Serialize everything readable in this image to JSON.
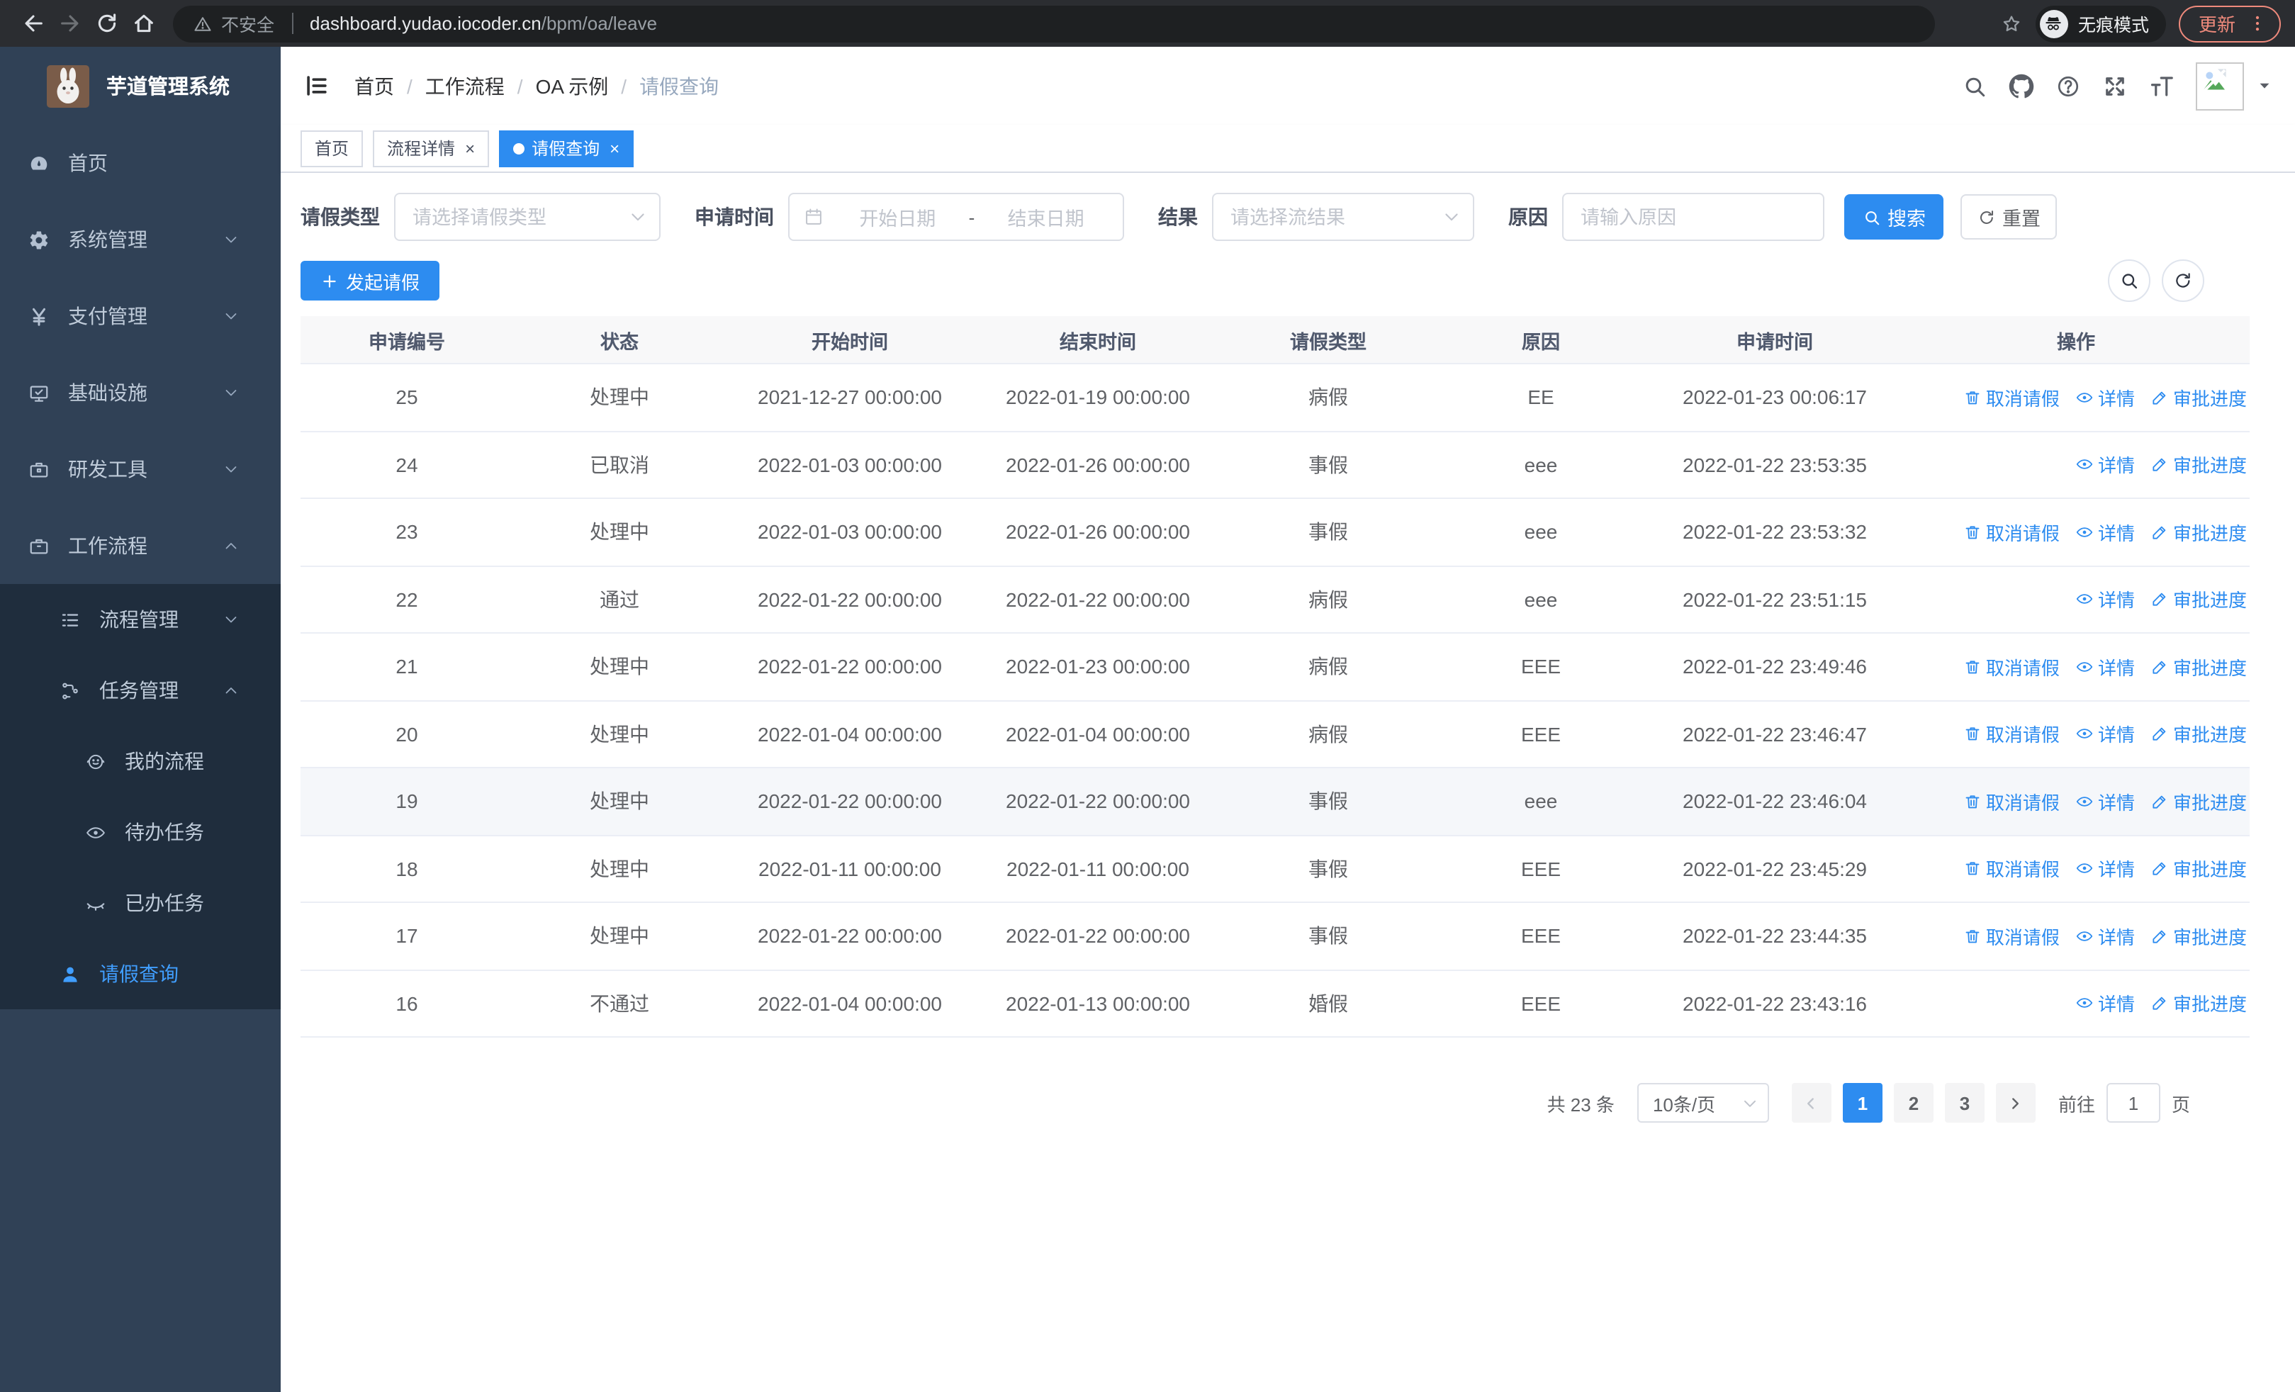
{
  "browser": {
    "security_label": "不安全",
    "url_host": "dashboard.yudao.iocoder.cn",
    "url_path": "/bpm/oa/leave",
    "incognito_label": "无痕模式",
    "update_label": "更新"
  },
  "sidebar": {
    "title": "芋道管理系统",
    "items": [
      {
        "key": "home",
        "label": "首页",
        "icon": "dashboard",
        "level": 1
      },
      {
        "key": "system-mgmt",
        "label": "系统管理",
        "icon": "gear",
        "level": 1,
        "chevron": "down"
      },
      {
        "key": "payment-mgmt",
        "label": "支付管理",
        "icon": "yen",
        "level": 1,
        "chevron": "down"
      },
      {
        "key": "infrastructure",
        "label": "基础设施",
        "icon": "monitor",
        "level": 1,
        "chevron": "down"
      },
      {
        "key": "dev-tools",
        "label": "研发工具",
        "icon": "toolbox",
        "level": 1,
        "chevron": "down"
      },
      {
        "key": "workflow",
        "label": "工作流程",
        "icon": "briefcase",
        "level": 1,
        "chevron": "up"
      },
      {
        "key": "process-mgmt",
        "label": "流程管理",
        "icon": "list",
        "level": 2,
        "chevron": "down",
        "dark": true
      },
      {
        "key": "task-mgmt",
        "label": "任务管理",
        "icon": "flow",
        "level": 2,
        "chevron": "up",
        "dark": true
      },
      {
        "key": "my-process",
        "label": "我的流程",
        "icon": "face",
        "level": 3,
        "dark": true
      },
      {
        "key": "todo-tasks",
        "label": "待办任务",
        "icon": "eye",
        "level": 3,
        "dark": true
      },
      {
        "key": "done-tasks",
        "label": "已办任务",
        "icon": "eye-closed",
        "level": 3,
        "dark": true
      },
      {
        "key": "leave-query",
        "label": "请假查询",
        "icon": "user",
        "level": 2,
        "dark": true,
        "active": true
      }
    ]
  },
  "breadcrumb": [
    "首页",
    "工作流程",
    "OA 示例",
    "请假查询"
  ],
  "tabs": [
    {
      "label": "首页",
      "closable": false,
      "active": false
    },
    {
      "label": "流程详情",
      "closable": true,
      "active": false
    },
    {
      "label": "请假查询",
      "closable": true,
      "active": true
    }
  ],
  "filters": {
    "type_label": "请假类型",
    "type_placeholder": "请选择请假类型",
    "time_label": "申请时间",
    "time_start_placeholder": "开始日期",
    "time_separator": "-",
    "time_end_placeholder": "结束日期",
    "result_label": "结果",
    "result_placeholder": "请选择流结果",
    "reason_label": "原因",
    "reason_placeholder": "请输入原因",
    "search_label": "搜索",
    "reset_label": "重置"
  },
  "toolbar": {
    "create_label": "发起请假"
  },
  "table": {
    "columns": [
      "申请编号",
      "状态",
      "开始时间",
      "结束时间",
      "请假类型",
      "原因",
      "申请时间",
      "操作"
    ],
    "action_labels": {
      "cancel": "取消请假",
      "detail": "详情",
      "progress": "审批进度"
    },
    "rows": [
      {
        "id": "25",
        "status": "处理中",
        "start": "2021-12-27 00:00:00",
        "end": "2022-01-19 00:00:00",
        "type": "病假",
        "reason": "EE",
        "apply_time": "2022-01-23 00:06:17",
        "cancel": true
      },
      {
        "id": "24",
        "status": "已取消",
        "start": "2022-01-03 00:00:00",
        "end": "2022-01-26 00:00:00",
        "type": "事假",
        "reason": "eee",
        "apply_time": "2022-01-22 23:53:35",
        "cancel": false
      },
      {
        "id": "23",
        "status": "处理中",
        "start": "2022-01-03 00:00:00",
        "end": "2022-01-26 00:00:00",
        "type": "事假",
        "reason": "eee",
        "apply_time": "2022-01-22 23:53:32",
        "cancel": true
      },
      {
        "id": "22",
        "status": "通过",
        "start": "2022-01-22 00:00:00",
        "end": "2022-01-22 00:00:00",
        "type": "病假",
        "reason": "eee",
        "apply_time": "2022-01-22 23:51:15",
        "cancel": false
      },
      {
        "id": "21",
        "status": "处理中",
        "start": "2022-01-22 00:00:00",
        "end": "2022-01-23 00:00:00",
        "type": "病假",
        "reason": "EEE",
        "apply_time": "2022-01-22 23:49:46",
        "cancel": true
      },
      {
        "id": "20",
        "status": "处理中",
        "start": "2022-01-04 00:00:00",
        "end": "2022-01-04 00:00:00",
        "type": "病假",
        "reason": "EEE",
        "apply_time": "2022-01-22 23:46:47",
        "cancel": true
      },
      {
        "id": "19",
        "status": "处理中",
        "start": "2022-01-22 00:00:00",
        "end": "2022-01-22 00:00:00",
        "type": "事假",
        "reason": "eee",
        "apply_time": "2022-01-22 23:46:04",
        "cancel": true,
        "highlighted": true
      },
      {
        "id": "18",
        "status": "处理中",
        "start": "2022-01-11 00:00:00",
        "end": "2022-01-11 00:00:00",
        "type": "事假",
        "reason": "EEE",
        "apply_time": "2022-01-22 23:45:29",
        "cancel": true
      },
      {
        "id": "17",
        "status": "处理中",
        "start": "2022-01-22 00:00:00",
        "end": "2022-01-22 00:00:00",
        "type": "事假",
        "reason": "EEE",
        "apply_time": "2022-01-22 23:44:35",
        "cancel": true
      },
      {
        "id": "16",
        "status": "不通过",
        "start": "2022-01-04 00:00:00",
        "end": "2022-01-13 00:00:00",
        "type": "婚假",
        "reason": "EEE",
        "apply_time": "2022-01-22 23:43:16",
        "cancel": false
      }
    ]
  },
  "pagination": {
    "total_label": "共 23 条",
    "page_size": "10条/页",
    "pages": [
      "1",
      "2",
      "3"
    ],
    "active_page": "1",
    "goto_label": "前往",
    "goto_value": "1",
    "goto_suffix": "页"
  },
  "colors": {
    "primary": "#2d8cf0",
    "sidebar_bg": "#304156",
    "submenu_bg": "#1f2d3d",
    "sidebar_text": "#bfcbd9",
    "update_accent": "#ef8a7c",
    "table_header_bg": "#f8f8f9",
    "row_highlight": "#f5f7fa"
  }
}
